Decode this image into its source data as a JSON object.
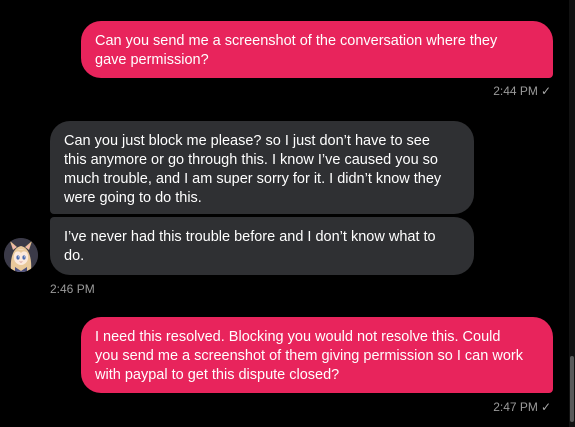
{
  "messages": [
    {
      "direction": "outgoing",
      "text": "Can you send me a screenshot of the conversation where they\ngave permission?",
      "time": "2:44 PM",
      "status_icon": "check-icon"
    },
    {
      "direction": "incoming",
      "text": "Can you just block me please? so I just don’t have to see\nthis anymore or go through this. I know I’ve caused you so\nmuch trouble, and I am super sorry for it. I didn’t know they\nwere going to do this."
    },
    {
      "direction": "incoming",
      "text": "I’ve never had this trouble before and I don’t know what to\ndo.",
      "time": "2:46 PM",
      "avatar_icon": "anime-girl-avatar"
    },
    {
      "direction": "outgoing",
      "text": "I need this resolved. Blocking you would not resolve this.  Could\nyou send me a screenshot of them giving permission so I can work\nwith paypal to get this dispute closed?",
      "time": "2:47 PM",
      "status_icon": "check-icon"
    }
  ],
  "check_glyph": "✓",
  "colors": {
    "background": "#000000",
    "outgoing_bubble": "#e8245c",
    "incoming_bubble": "#2f3033",
    "timestamp": "#9a9a9a"
  }
}
